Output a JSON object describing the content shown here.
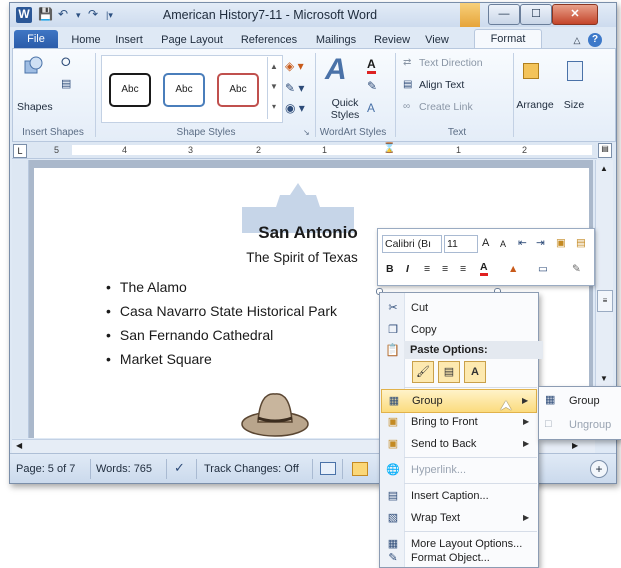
{
  "window": {
    "title": "American History7-11 - Microsoft Word",
    "controls": {
      "minimize": "—",
      "maximize": "☐",
      "close": "✕"
    }
  },
  "tabs": [
    "File",
    "Home",
    "Insert",
    "Page Layout",
    "References",
    "Mailings",
    "Review",
    "View",
    "Format"
  ],
  "active_tab": "Format",
  "ribbon": {
    "insert_shapes": {
      "shapes_label": "Shapes",
      "group_label": "Insert Shapes"
    },
    "shape_styles": {
      "styles": [
        "Abc",
        "Abc",
        "Abc"
      ],
      "style_colors": [
        "#1a1a1a",
        "#4a7ebb",
        "#c0504d"
      ],
      "group_label": "Shape Styles"
    },
    "wordart": {
      "quick_styles_label": "Quick Styles",
      "group_label": "WordArt Styles"
    },
    "text": {
      "text_direction": "Text Direction",
      "align_text": "Align Text",
      "create_link": "Create Link",
      "group_label": "Text"
    },
    "arrange": {
      "label": "Arrange"
    },
    "size": {
      "label": "Size"
    }
  },
  "document": {
    "title": "San Antonio",
    "subtitle": "The Spirit of Texas",
    "bullets": [
      "The Alamo",
      "Casa Navarro State Historical Park",
      "San Fernando Cathedral",
      "Market Square"
    ]
  },
  "mini_toolbar": {
    "font": "Calibri (Bı",
    "size": "11",
    "buttons_row1": [
      "A",
      "A",
      "⇤",
      "⇥",
      "▣",
      "▤"
    ],
    "buttons_row2": [
      "B",
      "I",
      "≡",
      "≡",
      "≡",
      "A",
      "▲",
      "▭",
      "✎"
    ]
  },
  "context_menu": {
    "cut": "Cut",
    "copy": "Copy",
    "paste_options": "Paste Options:",
    "group": "Group",
    "bring_to_front": "Bring to Front",
    "send_to_back": "Send to Back",
    "hyperlink": "Hyperlink...",
    "insert_caption": "Insert Caption...",
    "wrap_text": "Wrap Text",
    "more_layout": "More Layout Options...",
    "format_object": "Format Object..."
  },
  "submenu": {
    "group": "Group",
    "ungroup": "Ungroup"
  },
  "statusbar": {
    "page": "Page: 5 of 7",
    "words": "Words: 765",
    "track_changes": "Track Changes: Off"
  },
  "ruler_marks": [
    "5",
    "4",
    "3",
    "2",
    "1",
    "1",
    "2"
  ]
}
